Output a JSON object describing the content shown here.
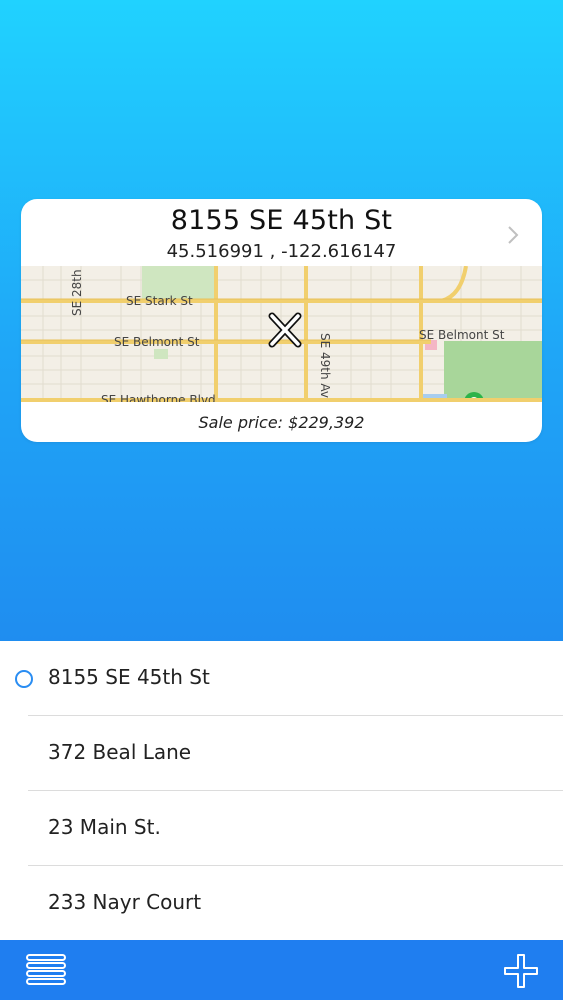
{
  "card": {
    "title": "8155 SE 45th St",
    "coordinates": "45.516991 , -122.616147",
    "price": "Sale price: $229,392",
    "chevron_icon": "chevron-right-icon"
  },
  "map": {
    "street_labels": {
      "se_28th": "SE 28th",
      "se_stark": "SE Stark St",
      "se_belmont_west": "SE Belmont St",
      "se_belmont_east": "SE Belmont St",
      "se_49th": "SE 49th Av",
      "se_hawthorne": "SE Hawthorne Blvd"
    },
    "marker_icon": "x-marker-icon"
  },
  "list": {
    "items": [
      {
        "label": "8155 SE 45th St",
        "selected": true
      },
      {
        "label": "372 Beal Lane",
        "selected": false
      },
      {
        "label": "23 Main St.",
        "selected": false
      },
      {
        "label": "233 Nayr Court",
        "selected": false
      }
    ]
  },
  "toolbar": {
    "menu_icon": "menu-icon",
    "add_icon": "plus-icon"
  },
  "colors": {
    "gradient_top": "#20d2ff",
    "gradient_bottom": "#1f8df0",
    "toolbar": "#1f7ef0",
    "accent": "#2a8df2"
  }
}
